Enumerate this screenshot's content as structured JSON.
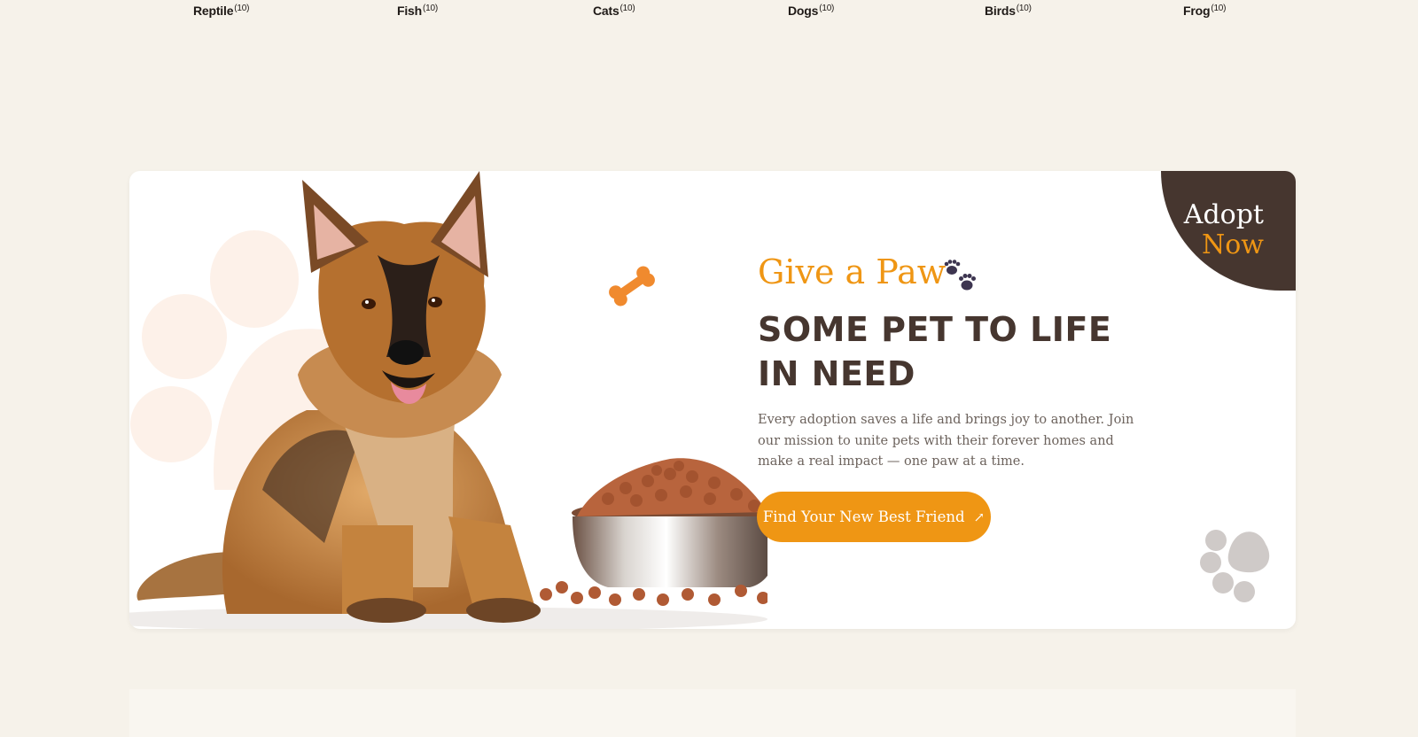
{
  "categories": [
    {
      "name": "Reptile",
      "count": "(10)"
    },
    {
      "name": "Fish",
      "count": "(10)"
    },
    {
      "name": "Cats",
      "count": "(10)"
    },
    {
      "name": "Dogs",
      "count": "(10)"
    },
    {
      "name": "Birds",
      "count": "(10)"
    },
    {
      "name": "Frog",
      "count": "(10)"
    }
  ],
  "banner": {
    "badge_line1": "Adopt",
    "badge_line2": "Now",
    "eyebrow": "Give a Paw",
    "headline": "SOME PET TO LIFE IN NEED",
    "description": "Every adoption saves a life and brings joy to another. Join our mission to unite pets with their forever homes and make a real impact — one paw at a time.",
    "cta_label": "Find Your New Best Friend",
    "cta_arrow": "↗"
  },
  "icons": {
    "bone": "bone-icon",
    "paw_prints": "paw-prints-icon",
    "paw_decor": "paw-icon"
  },
  "colors": {
    "page_bg": "#f6f2ea",
    "accent": "#ef9614",
    "dark_brown": "#46362f",
    "text_muted": "#6c625c",
    "card_bg": "#ffffff"
  }
}
